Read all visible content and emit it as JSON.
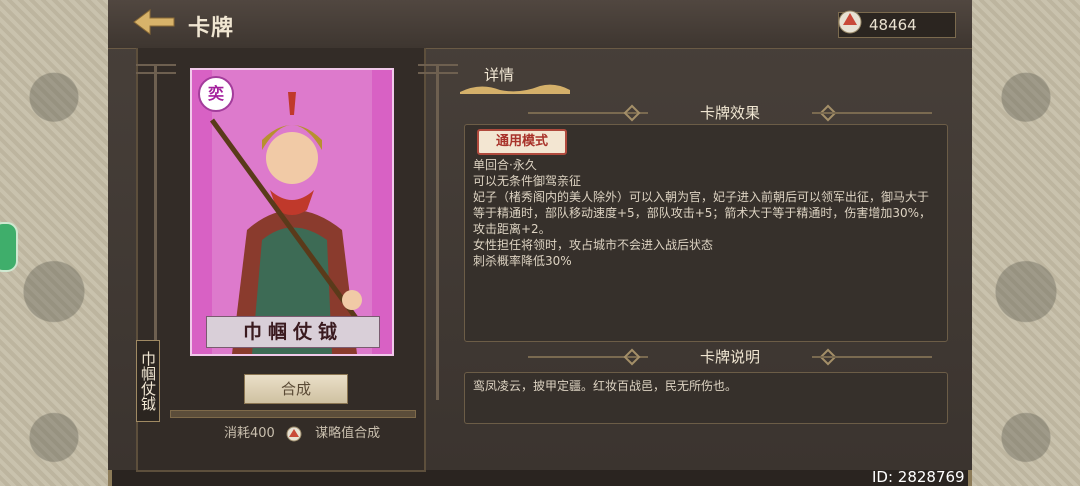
{
  "header": {
    "title": "卡牌",
    "currency_value": "48464"
  },
  "card": {
    "name": "巾帼仗钺",
    "vertical_name": "巾帼仗钺",
    "badge": "奕",
    "synthesize_label": "合成",
    "progress": 0,
    "cost_label": "消耗400",
    "cost_suffix": "谋略值合成"
  },
  "detail": {
    "tab_label": "详情",
    "effect_title": "卡牌效果",
    "mode_tag": "通用模式",
    "effect_lines": [
      "单回合·永久",
      "可以无条件御驾亲征",
      "妃子（楮秀阁内的美人除外）可以入朝为官，妃子进入前朝后可以领军出征，御马大于等于精通时，部队移动速度+5，部队攻击+5；箭术大于等于精通时，伤害增加30%，攻击距离+2。",
      "女性担任将领时，攻占城市不会进入战后状态",
      "刺杀概率降低30%"
    ],
    "desc_title": "卡牌说明",
    "desc_text": "鸾凤凌云，披甲定疆。红妆百战邑，民无所伤也。"
  },
  "footer": {
    "id_text": "ID: 2828769"
  },
  "colors": {
    "card_border": "#f1c9ea",
    "accent_gold": "#d4b06a",
    "mode_tag_red": "#b04a3d"
  },
  "icons": [
    "back-arrow-icon",
    "currency-icon",
    "cost-icon"
  ]
}
